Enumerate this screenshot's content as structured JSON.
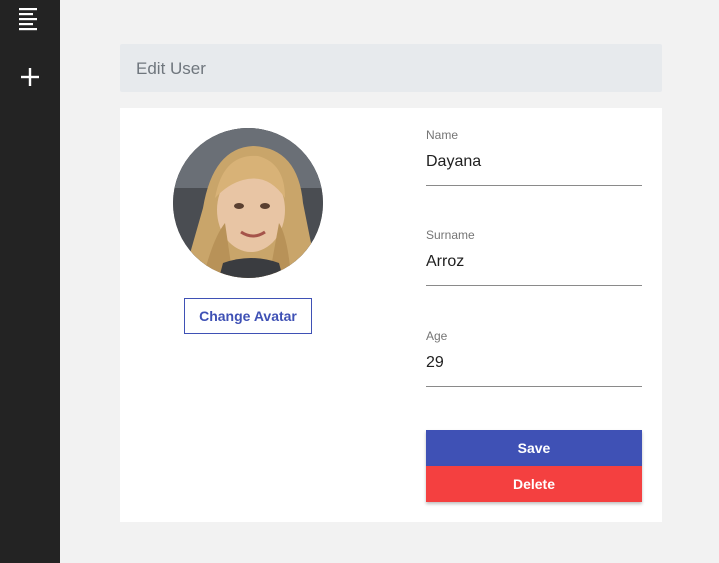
{
  "sidebar": {
    "items": [
      {
        "icon": "menu-icon"
      },
      {
        "icon": "plus-icon"
      }
    ]
  },
  "header": {
    "title": "Edit User"
  },
  "profile": {
    "change_avatar_label": "Change Avatar"
  },
  "form": {
    "name": {
      "label": "Name",
      "value": "Dayana"
    },
    "surname": {
      "label": "Surname",
      "value": "Arroz"
    },
    "age": {
      "label": "Age",
      "value": "29"
    }
  },
  "actions": {
    "save_label": "Save",
    "delete_label": "Delete"
  },
  "colors": {
    "primary": "#3f51b5",
    "danger": "#f44040",
    "sidebar": "#232323"
  }
}
